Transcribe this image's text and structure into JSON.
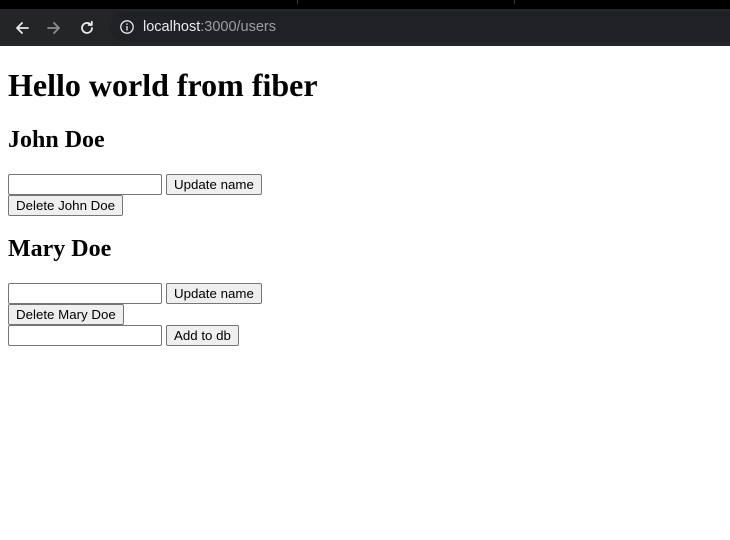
{
  "browser": {
    "url_host": "localhost",
    "url_path": ":3000/users",
    "icons": [
      "back-arrow-icon",
      "forward-arrow-icon",
      "reload-icon",
      "info-icon"
    ]
  },
  "page": {
    "heading": "Hello world from fiber",
    "users": [
      {
        "name": "John Doe",
        "update_label": "Update name",
        "delete_label": "Delete John Doe"
      },
      {
        "name": "Mary Doe",
        "update_label": "Update name",
        "delete_label": "Delete Mary Doe"
      }
    ],
    "add_label": "Add to db"
  }
}
